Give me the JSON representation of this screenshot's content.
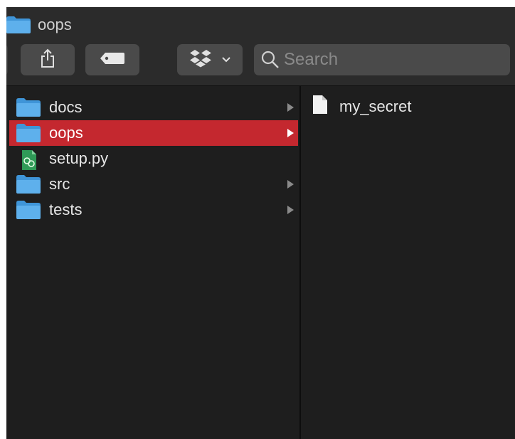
{
  "window": {
    "title": "oops"
  },
  "toolbar": {
    "share_icon": "share-icon",
    "tag_icon": "tag-icon",
    "dropbox_icon": "dropbox-icon",
    "search_placeholder": "Search"
  },
  "browser": {
    "left_column": [
      {
        "label": "docs",
        "type": "folder",
        "has_children": true,
        "selected": false
      },
      {
        "label": "oops",
        "type": "folder",
        "has_children": true,
        "selected": true
      },
      {
        "label": "setup.py",
        "type": "python-file",
        "has_children": false,
        "selected": false
      },
      {
        "label": "src",
        "type": "folder",
        "has_children": true,
        "selected": false
      },
      {
        "label": "tests",
        "type": "folder",
        "has_children": true,
        "selected": false
      }
    ],
    "right_column": [
      {
        "label": "my_secret",
        "type": "document"
      }
    ]
  },
  "colors": {
    "selection": "#c4282f",
    "folder": "#3f95d8",
    "window_bg": "#1e1e1e",
    "toolbar_bg": "#2b2b2b"
  }
}
